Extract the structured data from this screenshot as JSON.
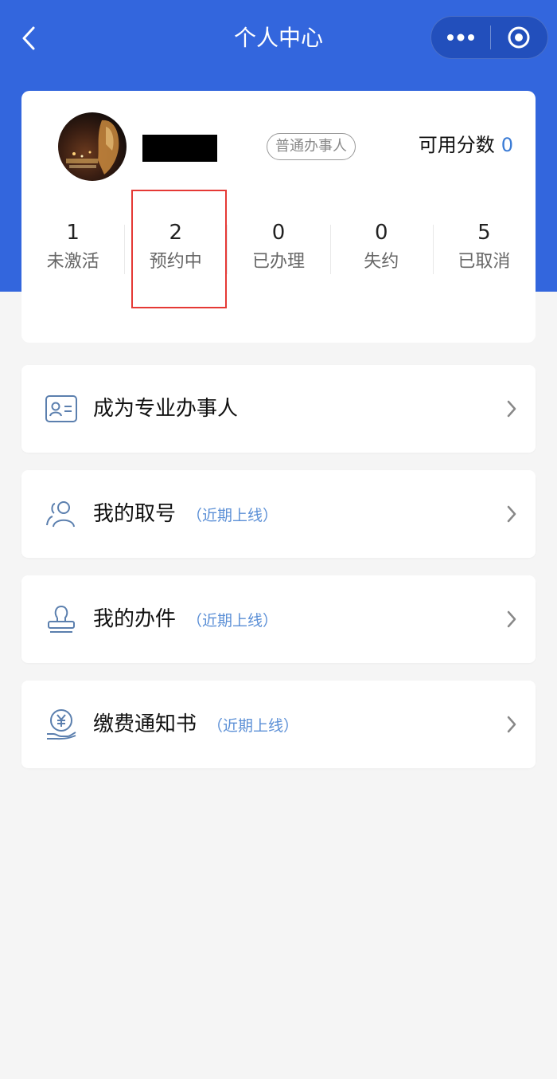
{
  "nav": {
    "title": "个人中心"
  },
  "profile": {
    "role_badge": "普通办事人",
    "points_label": "可用分数",
    "points_value": "0"
  },
  "stats": [
    {
      "value": "1",
      "label": "未激活"
    },
    {
      "value": "2",
      "label": "预约中"
    },
    {
      "value": "0",
      "label": "已办理"
    },
    {
      "value": "0",
      "label": "失约"
    },
    {
      "value": "5",
      "label": "已取消"
    }
  ],
  "menu": [
    {
      "label": "成为专业办事人",
      "note": "",
      "icon": "id-card-icon"
    },
    {
      "label": "我的取号",
      "note": "（近期上线）",
      "icon": "users-icon"
    },
    {
      "label": "我的办件",
      "note": "（近期上线）",
      "icon": "stamp-icon"
    },
    {
      "label": "缴费通知书",
      "note": "（近期上线）",
      "icon": "yuan-hand-icon"
    }
  ],
  "colors": {
    "header_blue": "#3366dd",
    "accent": "#3a7bd5",
    "highlight_red": "#e53935"
  }
}
